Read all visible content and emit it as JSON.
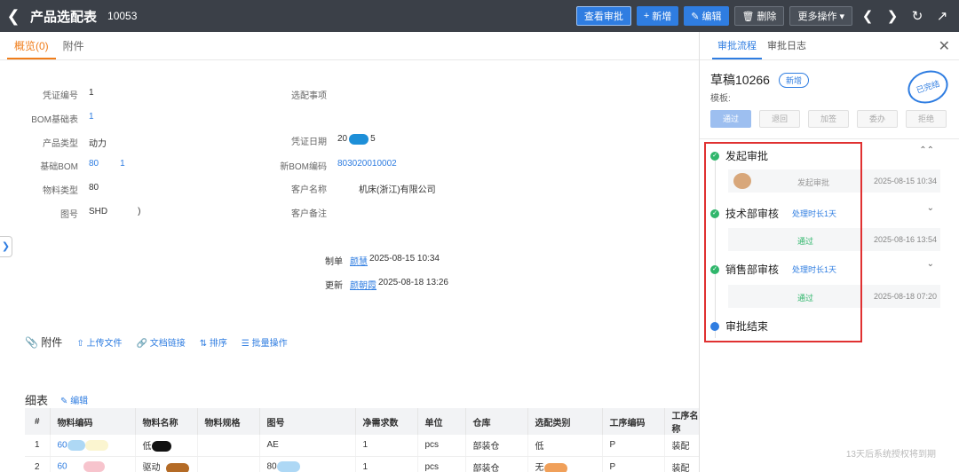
{
  "header": {
    "back_icon": "chevron-left-icon",
    "title": "产品选配表",
    "doc_no": "10053",
    "buttons": {
      "view_approval": "查看审批",
      "add": "新增",
      "edit": "编辑",
      "delete": "删除",
      "more": "更多操作"
    }
  },
  "tabs": [
    {
      "label": "概览(0)"
    },
    {
      "label": "附件"
    }
  ],
  "form": {
    "voucher_no": {
      "label": "凭证编号",
      "value": "1"
    },
    "bom_base": {
      "label": "BOM基础表",
      "value": "1"
    },
    "product_type": {
      "label": "产品类型",
      "value": "动力"
    },
    "base_bom": {
      "label": "基础BOM",
      "value": "80",
      "value2": "1"
    },
    "material_type": {
      "label": "物料类型",
      "value": "80"
    },
    "drawing_no": {
      "label": "图号",
      "value": "SHD",
      "value2": ")"
    },
    "selection_item": {
      "label": "选配事项",
      "value": ""
    },
    "voucher_date": {
      "label": "凭证日期",
      "value": "20",
      "value2": "5"
    },
    "new_bom_code": {
      "label": "新BOM编码",
      "value": "803020010002"
    },
    "customer_name": {
      "label": "客户名称",
      "value": "机床(浙江)有限公司"
    },
    "customer_remark": {
      "label": "客户备注",
      "value": ""
    }
  },
  "meta": {
    "created": {
      "label": "制单",
      "user": "颜慧",
      "time": "2025-08-15 10:34"
    },
    "updated": {
      "label": "更新",
      "user": "颜朝霞",
      "time": "2025-08-18 13:26"
    }
  },
  "attach": {
    "label": "附件",
    "upload": "上传文件",
    "doc_link": "文档链接",
    "sort": "排序",
    "batch": "批量操作"
  },
  "detail": {
    "title": "细表",
    "edit": "编辑",
    "columns": [
      "#",
      "物料编码",
      "物料名称",
      "物料规格",
      "图号",
      "净需求数",
      "单位",
      "仓库",
      "选配类别",
      "工序编码",
      "工序名称"
    ],
    "rows": [
      [
        "1",
        "60",
        "低",
        "",
        "AE",
        "1",
        "pcs",
        "部装仓",
        "低",
        "P",
        "装配"
      ],
      [
        "2",
        "60",
        "驱动",
        "",
        "80",
        "1",
        "pcs",
        "部装仓",
        "无",
        "P",
        "装配"
      ]
    ]
  },
  "panel": {
    "tabs": [
      {
        "label": "审批流程"
      },
      {
        "label": "审批日志"
      }
    ],
    "draft_name": "草稿10266",
    "draft_badge": "新增",
    "template_label": "模板:",
    "stamp": "已完结",
    "actions": [
      "通过",
      "退回",
      "加签",
      "委办",
      "拒绝"
    ],
    "steps": [
      {
        "name": "发起审批",
        "duration": "",
        "record_action": "发起审批",
        "record_time": "2025-08-15 10:34"
      },
      {
        "name": "技术部审核",
        "duration": "处理时长1天",
        "record_action": "通过",
        "record_time": "2025-08-16 13:54"
      },
      {
        "name": "销售部审核",
        "duration": "处理时长1天",
        "record_action": "通过",
        "record_time": "2025-08-18 07:20"
      },
      {
        "name": "审批结束",
        "duration": "",
        "record_action": "",
        "record_time": ""
      }
    ],
    "expire_note": "13天后系统授权将到期"
  },
  "colors": {
    "primary": "#2f7de1",
    "active_tab": "#f07d1a",
    "success": "#2fb66b",
    "highlight": "#e03131",
    "topbar": "#3b4048"
  }
}
